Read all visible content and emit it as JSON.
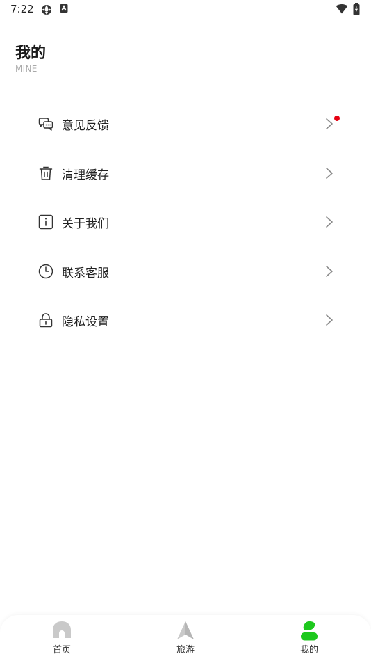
{
  "status_bar": {
    "time": "7:22"
  },
  "header": {
    "title": "我的",
    "subtitle": "MINE"
  },
  "menu": {
    "items": [
      {
        "label": "意见反馈",
        "icon": "feedback-icon",
        "has_badge": true
      },
      {
        "label": "清理缓存",
        "icon": "trash-icon"
      },
      {
        "label": "关于我们",
        "icon": "info-icon"
      },
      {
        "label": "联系客服",
        "icon": "clock-icon"
      },
      {
        "label": "隐私设置",
        "icon": "lock-icon"
      }
    ]
  },
  "bottom_nav": {
    "items": [
      {
        "label": "首页",
        "icon": "home-icon"
      },
      {
        "label": "旅游",
        "icon": "travel-icon"
      },
      {
        "label": "我的",
        "icon": "profile-icon",
        "active": true
      }
    ]
  },
  "colors": {
    "accent": "#1ec81e",
    "badge": "#e60012",
    "inactive_icon": "#c9c9c9"
  }
}
